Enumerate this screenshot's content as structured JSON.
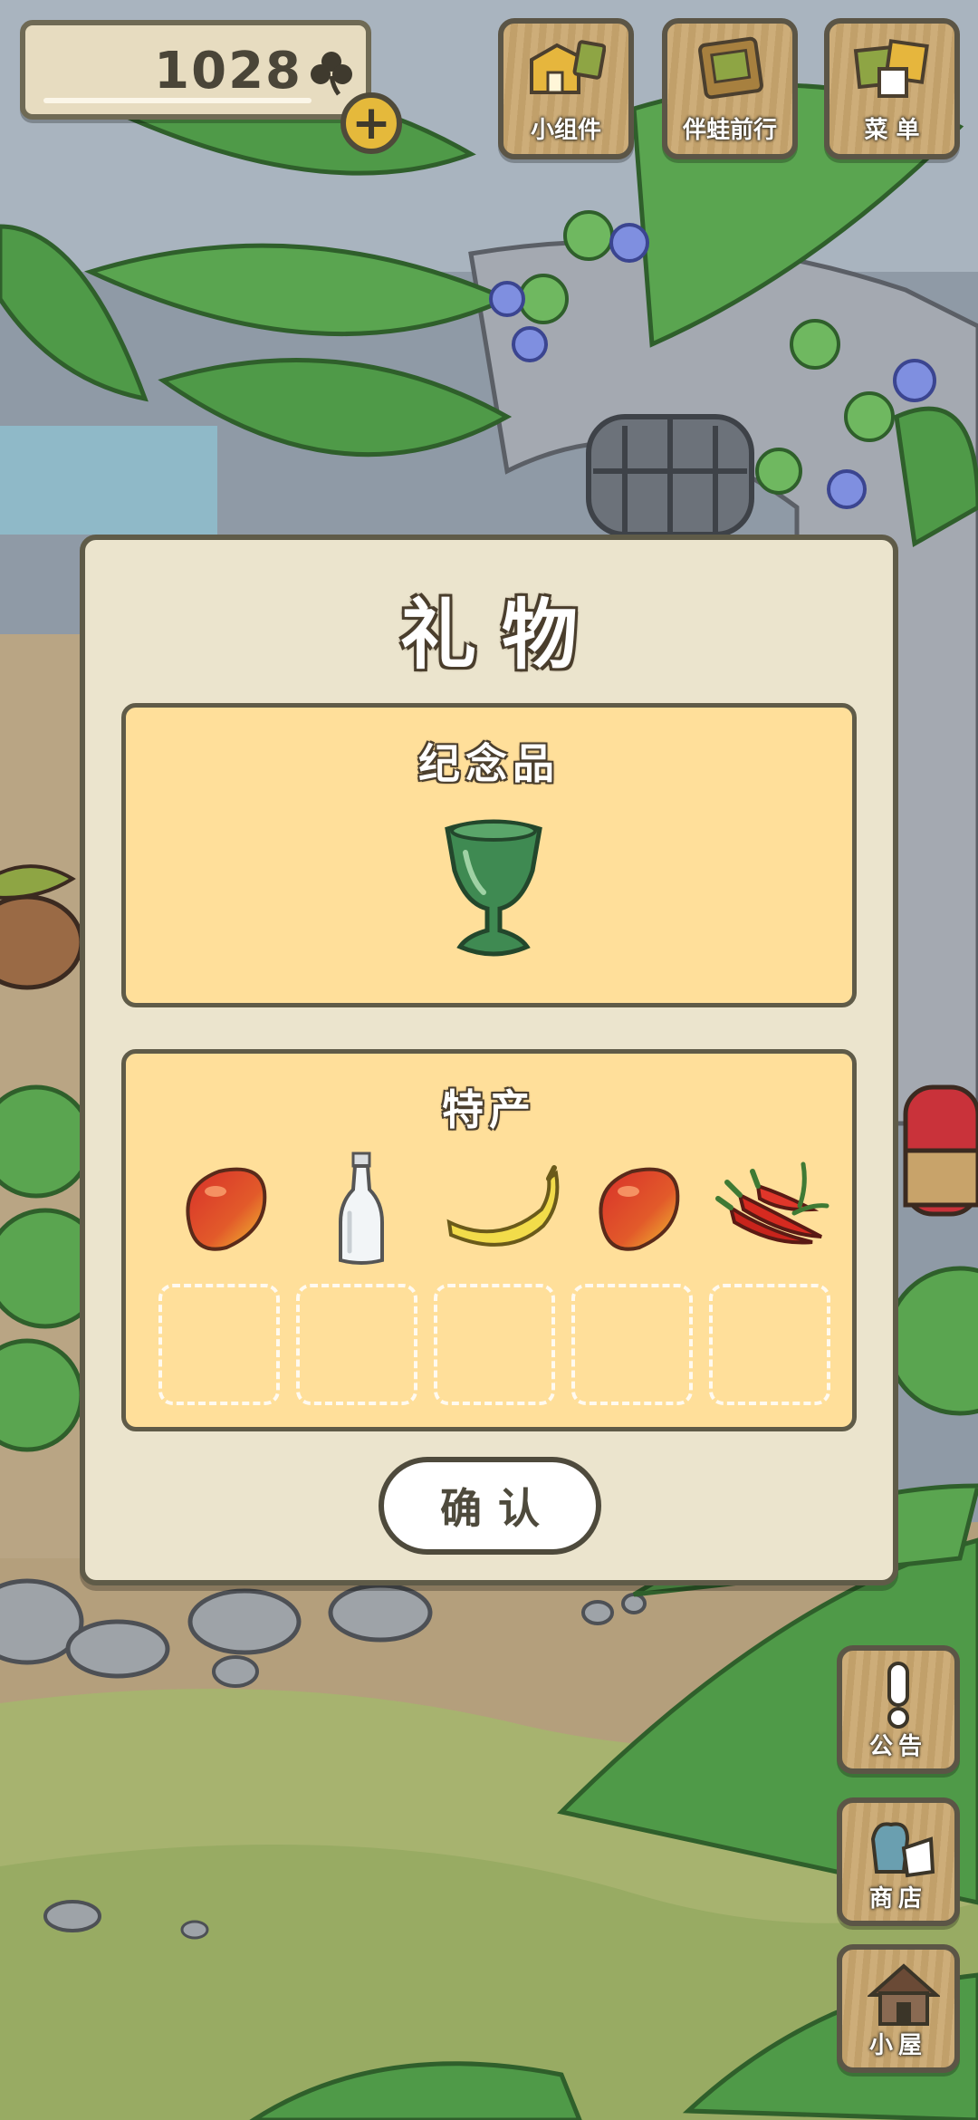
{
  "hud": {
    "clover_count": "1028",
    "clover_icon": "clover-icon",
    "plus_icon": "+"
  },
  "top_buttons": [
    {
      "label": "小组件",
      "icon": "widget-icon"
    },
    {
      "label": "伴蛙前行",
      "icon": "album-icon"
    },
    {
      "label": "菜 单",
      "icon": "menu-icon"
    }
  ],
  "side_buttons": [
    {
      "label": "公告",
      "icon": "exclamation-icon"
    },
    {
      "label": "商店",
      "icon": "shop-bag-icon"
    },
    {
      "label": "小屋",
      "icon": "house-icon"
    }
  ],
  "dialog": {
    "title": "礼物",
    "souvenir": {
      "title": "纪念品",
      "item": "green-goblet-icon"
    },
    "specialty": {
      "title": "特产",
      "items": [
        "mango-icon",
        "glass-bottle-icon",
        "banana-icon",
        "mango-icon",
        "chili-peppers-icon"
      ],
      "empty_slots": 5
    },
    "confirm_label": "确认"
  },
  "colors": {
    "panel_bg": "#ebe4cd",
    "box_bg": "#ffdf9a",
    "border": "#5f5b48",
    "wood": "#c9a66e",
    "plus_yellow": "#e5b93b"
  }
}
